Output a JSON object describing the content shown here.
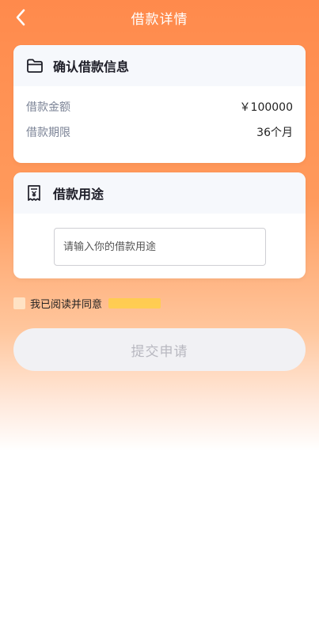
{
  "header": {
    "title": "借款详情"
  },
  "loan_info": {
    "title": "确认借款信息",
    "rows": [
      {
        "label": "借款金额",
        "value": "￥100000"
      },
      {
        "label": "借款期限",
        "value": "36个月"
      }
    ]
  },
  "purpose": {
    "title": "借款用途",
    "placeholder": "请输入你的借款用途"
  },
  "agreement": {
    "text": "我已阅读并同意"
  },
  "submit": {
    "label": "提交申请"
  },
  "colors": {
    "header_gradient_top": "#ff8a4c",
    "accent_orange": "#ff8a4c",
    "card_head_bg": "#f6f8fc",
    "checkbox": "#ffe2c4",
    "agreement_link": "#ffd23d",
    "button_disabled_bg": "#f1f1f4",
    "button_disabled_text": "#b8b8c0"
  },
  "icons": {
    "back": "chevron-left-icon",
    "loan_info": "folder-icon",
    "purpose": "receipt-icon"
  }
}
